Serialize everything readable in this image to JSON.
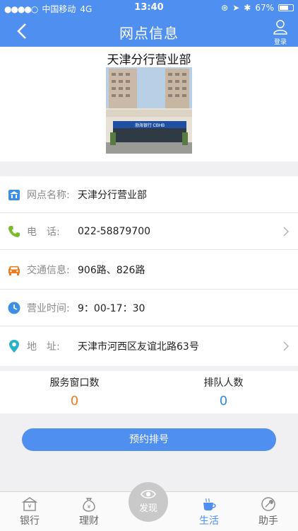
{
  "status_bar": {
    "carrier": "中国移动",
    "network": "4G",
    "time": "13:40",
    "battery": "67%",
    "battery_level": 0.67
  },
  "nav": {
    "title": "网点信息",
    "login_label": "登录"
  },
  "branch": {
    "title": "天津分行营业部",
    "sign_text": "渤海银行 CBHB"
  },
  "info": [
    {
      "label": "网点名称:",
      "value": "天津分行营业部",
      "icon": "bank-icon"
    },
    {
      "label": "电　话:",
      "value": "022-58879700",
      "icon": "phone-icon"
    },
    {
      "label": "交通信息:",
      "value": "906路、826路",
      "icon": "car-icon"
    },
    {
      "label": "营业时间:",
      "value": "9：00-17：30",
      "icon": "clock-icon"
    },
    {
      "label": "地　址:",
      "value": "天津市河西区友谊北路63号",
      "icon": "location-pin-icon"
    }
  ],
  "stats": {
    "windows_label": "服务窗口数",
    "windows_value": "0",
    "queue_label": "排队人数",
    "queue_value": "0"
  },
  "reserve_button": "预约排号",
  "tabs": [
    {
      "label": "银行",
      "icon": "bank-tab-icon"
    },
    {
      "label": "理财",
      "icon": "money-bag-icon"
    },
    {
      "label": "发现",
      "icon": "eye-icon"
    },
    {
      "label": "生活",
      "icon": "cup-icon"
    },
    {
      "label": "助手",
      "icon": "wrench-icon"
    }
  ],
  "colors": {
    "primary": "#4e8ff0",
    "windows_count": "#f07a1c",
    "queue_count": "#2e8be6"
  }
}
